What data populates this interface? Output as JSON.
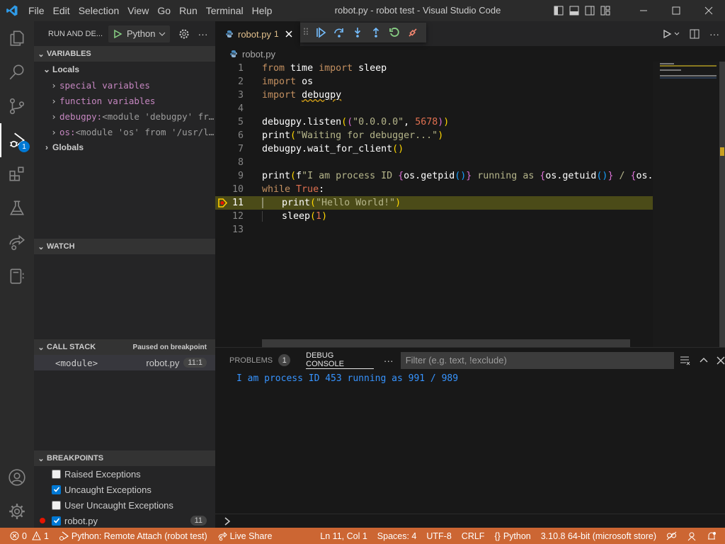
{
  "titlebar": {
    "menu": [
      "File",
      "Edit",
      "Selection",
      "View",
      "Go",
      "Run",
      "Terminal",
      "Help"
    ],
    "title": "robot.py - robot test - Visual Studio Code"
  },
  "activity_bar": {
    "items": [
      "explorer",
      "search",
      "source-control",
      "run-and-debug",
      "extensions",
      "testing",
      "live-share",
      "notebook"
    ],
    "debug_badge": "1"
  },
  "sidebar": {
    "header": "RUN AND DE...",
    "config_label": "Python",
    "variables": {
      "title": "VARIABLES",
      "locals_label": "Locals",
      "items": [
        {
          "name": "special variables",
          "value": ""
        },
        {
          "name": "function variables",
          "value": ""
        },
        {
          "name": "debugpy:",
          "value": " <module 'debugpy' fr…"
        },
        {
          "name": "os:",
          "value": " <module 'os' from '/usr/l…"
        }
      ],
      "globals_label": "Globals"
    },
    "watch": {
      "title": "WATCH"
    },
    "call_stack": {
      "title": "CALL STACK",
      "status": "Paused on breakpoint",
      "frames": [
        {
          "name": "<module>",
          "file": "robot.py",
          "pos": "11:1"
        }
      ]
    },
    "breakpoints": {
      "title": "BREAKPOINTS",
      "items": [
        {
          "label": "Raised Exceptions",
          "checked": false
        },
        {
          "label": "Uncaught Exceptions",
          "checked": true
        },
        {
          "label": "User Uncaught Exceptions",
          "checked": false
        },
        {
          "label": "robot.py",
          "checked": true,
          "line": "11"
        }
      ]
    }
  },
  "editor": {
    "tab": {
      "label": "robot.py",
      "problems": "1"
    },
    "breadcrumb": "robot.py",
    "current_line": 11,
    "lines": [
      "from time import sleep",
      "import os",
      "import debugpy",
      "",
      "debugpy.listen((\"0.0.0.0\", 5678))",
      "print(\"Waiting for debugger...\")",
      "debugpy.wait_for_client()",
      "",
      "print(f\"I am process ID {os.getpid()} running as {os.getuid()} / {os.getgid()}\"",
      "while True:",
      "    print(\"Hello World!\")",
      "    sleep(1)",
      ""
    ]
  },
  "panel": {
    "tabs": [
      {
        "label": "PROBLEMS",
        "badge": "1"
      },
      {
        "label": "DEBUG CONSOLE",
        "active": true
      }
    ],
    "filter_placeholder": "Filter (e.g. text, !exclude)",
    "output": "I am process ID 453 running as 991 / 989"
  },
  "statusbar": {
    "errors": "0",
    "warnings": "1",
    "debug_config": "Python: Remote Attach (robot test)",
    "live_share": "Live Share",
    "position": "Ln 11, Col 1",
    "spaces": "Spaces: 4",
    "encoding": "UTF-8",
    "eol": "CRLF",
    "language": "Python",
    "interpreter": "3.10.8 64-bit (microsoft store)"
  },
  "colors": {
    "statusbar": "#cc6633",
    "accent": "#0078d4",
    "breakpoint": "#e51400"
  }
}
